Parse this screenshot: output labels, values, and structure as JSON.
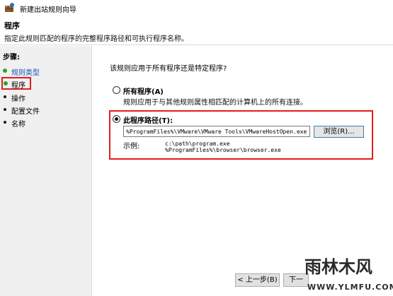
{
  "window": {
    "title": "新建出站规则向导"
  },
  "header": {
    "title": "程序",
    "description": "指定此规则匹配的程序的完整程序路径和可执行程序名称。"
  },
  "steps": {
    "title": "步骤:",
    "items": [
      {
        "label": "规则类型",
        "state": "done"
      },
      {
        "label": "程序",
        "state": "current"
      },
      {
        "label": "操作",
        "state": "pending"
      },
      {
        "label": "配置文件",
        "state": "pending"
      },
      {
        "label": "名称",
        "state": "pending"
      }
    ]
  },
  "content": {
    "question": "该规则应用于所有程序还是特定程序?",
    "all_programs": {
      "label": "所有程序(A)",
      "description": "规则应用于与其他规则属性相匹配的计算机上的所有连接。",
      "selected": false
    },
    "program_path": {
      "label": "此程序路径(T):",
      "selected": true,
      "value": "%ProgramFiles%\\VMware\\VMware Tools\\VMwareHostOpen.exe",
      "browse_label": "浏览(R)...",
      "example_label": "示例:",
      "examples": [
        "c:\\path\\program.exe",
        "%ProgramFiles%\\browser\\browser.exe"
      ]
    }
  },
  "buttons": {
    "back": "< 上一步(B)",
    "next": "下一"
  },
  "watermark": {
    "main": "雨林木风",
    "sub": "WWW.YLMFU.COM"
  },
  "colors": {
    "highlight": "#e11d1d",
    "step_done": "#1a56b8",
    "step_dot": "#22aa22"
  }
}
